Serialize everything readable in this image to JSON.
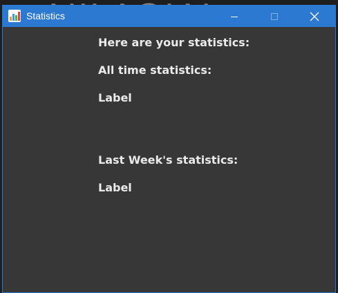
{
  "window": {
    "title": "Statistics",
    "icon": "bar-chart-icon",
    "accent_color": "#2b79d0",
    "background_color": "#373737"
  },
  "titlebar_buttons": {
    "minimize_icon": "minimize-icon",
    "maximize_icon": "maximize-icon",
    "close_icon": "close-icon"
  },
  "content": {
    "heading": "Here are your statistics:",
    "all_time_header": "All time statistics:",
    "all_time_value": "Label",
    "last_week_header": "Last Week's statistics:",
    "last_week_value": "Label"
  }
}
